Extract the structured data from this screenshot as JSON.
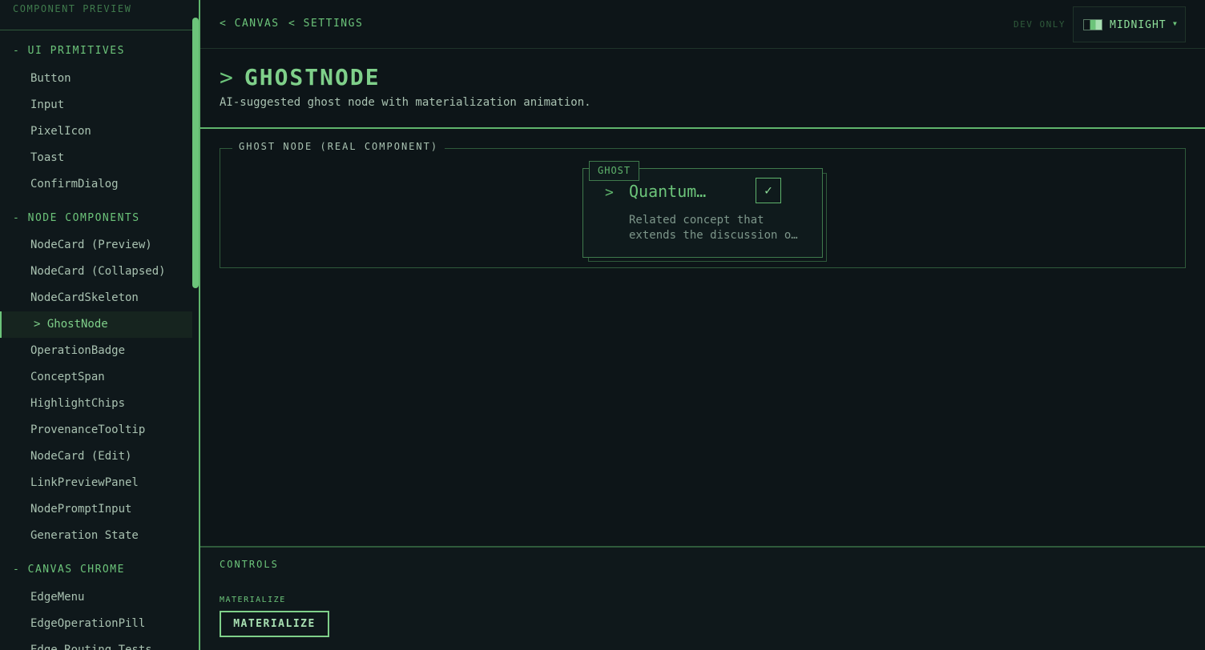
{
  "sidebar": {
    "title": "COMPONENT PREVIEW",
    "sections": [
      {
        "label": "- UI PRIMITIVES",
        "items": [
          "Button",
          "Input",
          "PixelIcon",
          "Toast",
          "ConfirmDialog"
        ]
      },
      {
        "label": "- NODE COMPONENTS",
        "items": [
          "NodeCard (Preview)",
          "NodeCard (Collapsed)",
          "NodeCardSkeleton",
          "> GhostNode",
          "OperationBadge",
          "ConceptSpan",
          "HighlightChips",
          "ProvenanceTooltip",
          "NodeCard (Edit)",
          "LinkPreviewPanel",
          "NodePromptInput",
          "Generation State"
        ]
      },
      {
        "label": "- CANVAS CHROME",
        "items": [
          "EdgeMenu",
          "EdgeOperationPill",
          "Edge Routing Tests"
        ]
      }
    ],
    "active_item": "> GhostNode"
  },
  "header": {
    "crumb_canvas": "< CANVAS",
    "crumb_settings": "< SETTINGS",
    "dev_only": "DEV ONLY",
    "theme": "MIDNIGHT"
  },
  "page": {
    "title_chevron": ">",
    "title": "GHOSTNODE",
    "subtitle": "AI-suggested ghost node with materialization animation."
  },
  "preview": {
    "legend": "GHOST NODE (REAL COMPONENT)",
    "ghost_badge": "GHOST",
    "ghost_title": "Quantum…",
    "ghost_desc_line1": "Related concept that",
    "ghost_desc_line2": "extends the discussion o…"
  },
  "controls": {
    "title": "CONTROLS",
    "materialize_label": "MATERIALIZE",
    "materialize_button": "MATERIALIZE"
  },
  "colors": {
    "accent": "#6cc47a",
    "background": "#0d1518"
  }
}
